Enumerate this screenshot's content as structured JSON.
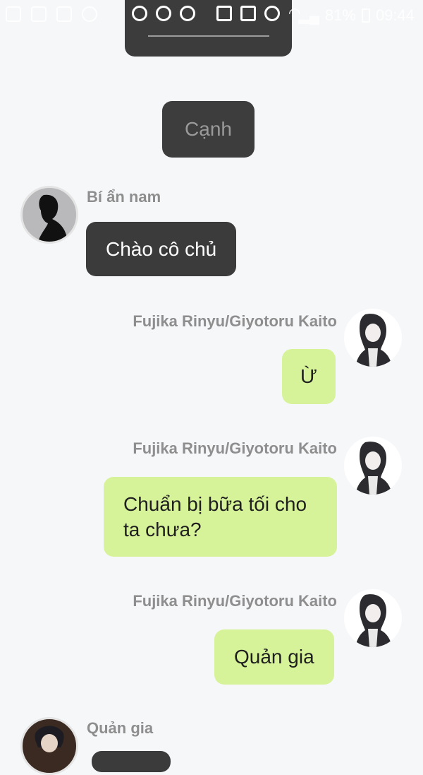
{
  "status_bar": {
    "battery": "81%",
    "time": "09:44",
    "icons": [
      "app-icon",
      "app-icon",
      "message-icon",
      "pinterest-icon",
      "maps-icon",
      "chrome-icon",
      "chrome-icon",
      "chrome-icon",
      "battery-saver-icon",
      "mute-icon",
      "alarm-icon",
      "wifi-icon",
      "signal-icon",
      "battery-icon"
    ]
  },
  "chat": {
    "narration": "Cạnh",
    "messages": [
      {
        "sender": "Bí ẩn nam",
        "text": "Chào cô chủ",
        "side": "left"
      },
      {
        "sender": "Fujika Rinyu/Giyotoru Kaito",
        "text": "Ừ",
        "side": "right"
      },
      {
        "sender": "Fujika Rinyu/Giyotoru Kaito",
        "text": "Chuẩn bị bữa tối cho ta chưa?",
        "side": "right"
      },
      {
        "sender": "Fujika Rinyu/Giyotoru Kaito",
        "text": "Quản gia",
        "side": "right"
      },
      {
        "sender": "Quản gia",
        "text": "",
        "side": "left"
      }
    ]
  },
  "colors": {
    "background": "#f6f7f9",
    "dark_bubble": "#3b3b3b",
    "green_bubble": "#d7f39a",
    "name_text": "#8e8e8e"
  }
}
